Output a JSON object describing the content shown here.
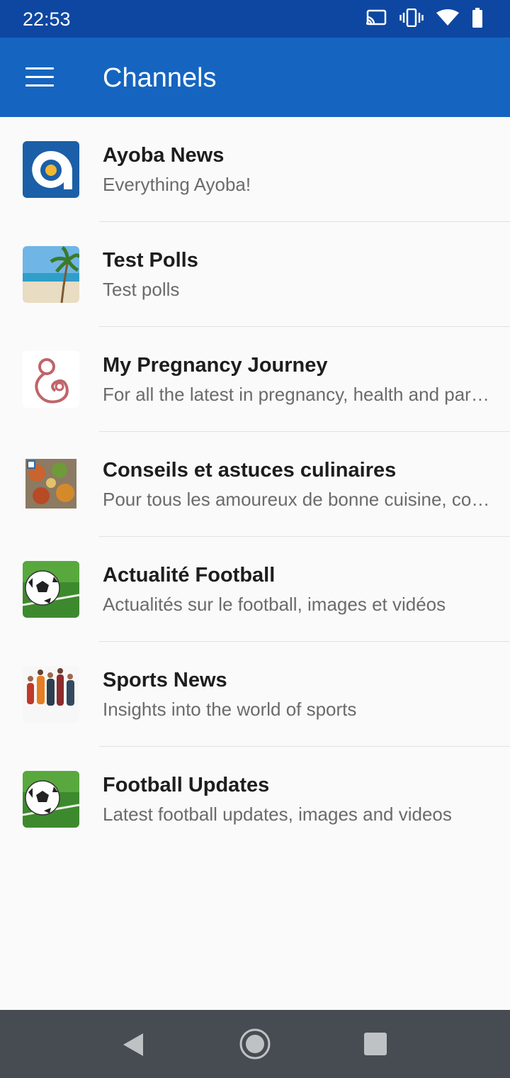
{
  "status_bar": {
    "time": "22:53",
    "icons": [
      "cast-icon",
      "vibrate-icon",
      "wifi-icon",
      "battery-icon"
    ]
  },
  "app_bar": {
    "title": "Channels",
    "menu_icon": "menu-icon"
  },
  "channels": [
    {
      "title": "Ayoba News",
      "subtitle": "Everything Ayoba!"
    },
    {
      "title": "Test Polls",
      "subtitle": "Test polls"
    },
    {
      "title": "My Pregnancy Journey",
      "subtitle": "For all the latest in pregnancy, health and parenting"
    },
    {
      "title": "Conseils et astuces culinaires",
      "subtitle": "Pour tous les amoureux de bonne cuisine, conseils et astuces"
    },
    {
      "title": "Actualité Football",
      "subtitle": "Actualités sur le football, images et vidéos"
    },
    {
      "title": "Sports News",
      "subtitle": "Insights into the world of sports"
    },
    {
      "title": "Football Updates",
      "subtitle": "Latest football updates, images and videos"
    }
  ],
  "nav_bar": {
    "icons": [
      "back-icon",
      "home-icon",
      "recents-icon"
    ]
  },
  "colors": {
    "status_bar": "#0e47a1",
    "app_bar": "#1565c0",
    "background": "#fafafa",
    "nav_bar": "#474c52"
  }
}
